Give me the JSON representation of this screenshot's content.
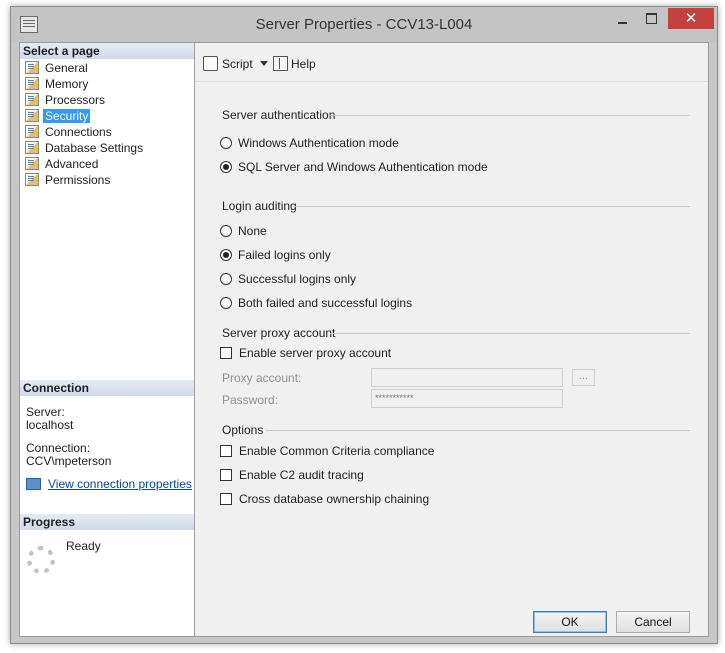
{
  "window": {
    "title": "Server Properties - CCV13-L004",
    "close_glyph": "✕"
  },
  "left_pane": {
    "select_page_header": "Select a page",
    "pages": [
      {
        "label": "General"
      },
      {
        "label": "Memory"
      },
      {
        "label": "Processors"
      },
      {
        "label": "Security"
      },
      {
        "label": "Connections"
      },
      {
        "label": "Database Settings"
      },
      {
        "label": "Advanced"
      },
      {
        "label": "Permissions"
      }
    ],
    "selected_page": "Security",
    "connection_header": "Connection",
    "server_label": "Server:",
    "server_value": "localhost",
    "connection_label": "Connection:",
    "connection_value": "CCV\\mpeterson",
    "view_link": "View connection properties",
    "progress_header": "Progress",
    "progress_status": "Ready"
  },
  "toolbar": {
    "script_label": "Script",
    "help_label": "Help"
  },
  "server_authentication": {
    "title": "Server authentication",
    "options": [
      {
        "label": "Windows Authentication mode",
        "selected": false
      },
      {
        "label": "SQL Server and Windows Authentication mode",
        "selected": true
      }
    ]
  },
  "login_auditing": {
    "title": "Login auditing",
    "options": [
      {
        "label": "None",
        "selected": false
      },
      {
        "label": "Failed logins only",
        "selected": true
      },
      {
        "label": "Successful logins only",
        "selected": false
      },
      {
        "label": "Both failed and successful logins",
        "selected": false
      }
    ]
  },
  "proxy": {
    "title": "Server proxy account",
    "enable_label": "Enable server proxy account",
    "enable_checked": false,
    "proxy_account_label": "Proxy account:",
    "proxy_account_value": "",
    "browse_label": "...",
    "password_label": "Password:",
    "password_value": "***********"
  },
  "options": {
    "title": "Options",
    "items": [
      {
        "label": "Enable Common Criteria compliance",
        "checked": false
      },
      {
        "label": "Enable C2 audit tracing",
        "checked": false
      },
      {
        "label": "Cross database ownership chaining",
        "checked": false
      }
    ]
  },
  "buttons": {
    "ok": "OK",
    "cancel": "Cancel"
  },
  "colors": {
    "selection": "#3399ff",
    "close_button": "#c74040",
    "link": "#0645ad"
  }
}
